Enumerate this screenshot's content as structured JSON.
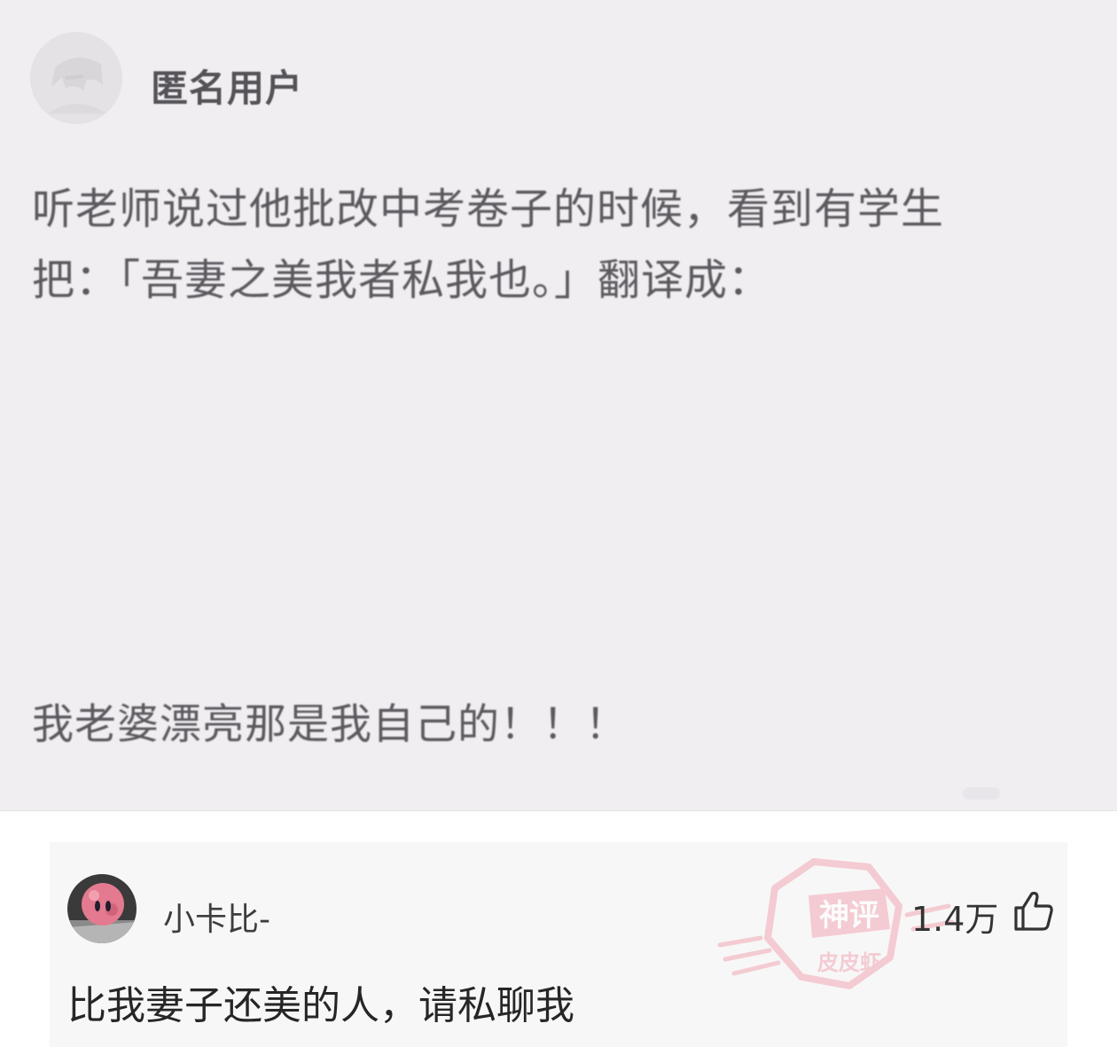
{
  "post": {
    "username": "匿名用户",
    "line1": "听老师说过他批改中考卷子的时候，看到有学生",
    "line2": "把：「吾妻之美我者私我也。」翻译成：",
    "answer": "我老婆漂亮那是我自己的！！！"
  },
  "comment": {
    "username": "小卡比-",
    "text": "比我妻子还美的人，请私聊我",
    "like_count": "1.4万",
    "like_icon": "thumbs-up-icon",
    "stamp_line1": "神评",
    "stamp_line2": "皮皮虾"
  },
  "colors": {
    "post_bg": "#f0eef1",
    "comment_bg": "#f7f7f7",
    "stamp": "#f2a8b4"
  }
}
